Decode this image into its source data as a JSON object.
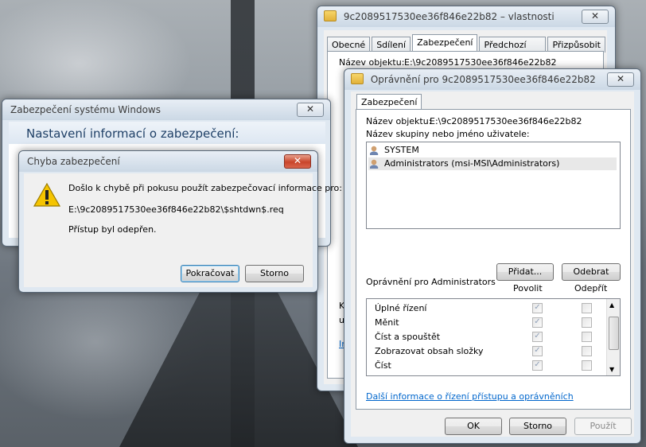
{
  "properties_window": {
    "title": "9c2089517530ee36f846e22b82 – vlastnosti",
    "tabs": [
      "Obecné",
      "Sdílení",
      "Zabezpečení",
      "Předchozí verze",
      "Přizpůsobit"
    ],
    "object_name_label": "Název objektu:",
    "object_name_value": "E:\\9c2089517530ee36f846e22b82",
    "partial_k": "K",
    "partial_u": "u",
    "partial_link": "Ir"
  },
  "permissions_window": {
    "title": "Oprávnění pro 9c2089517530ee36f846e22b82",
    "tab": "Zabezpečení",
    "object_name_label": "Název objektu:",
    "object_name_value": "E:\\9c2089517530ee36f846e22b82",
    "group_label": "Název skupiny nebo jméno uživatele:",
    "users": [
      "SYSTEM",
      "Administrators (msi-MSI\\Administrators)"
    ],
    "add_button": "Přidat...",
    "remove_button": "Odebrat",
    "permissions_for": "Oprávnění pro Administrators",
    "allow_header": "Povolit",
    "deny_header": "Odepřít",
    "permissions": [
      {
        "name": "Úplné řízení",
        "allow": true,
        "deny": false
      },
      {
        "name": "Měnit",
        "allow": true,
        "deny": false
      },
      {
        "name": "Číst a spouštět",
        "allow": true,
        "deny": false
      },
      {
        "name": "Zobrazovat obsah složky",
        "allow": true,
        "deny": false
      },
      {
        "name": "Číst",
        "allow": true,
        "deny": false
      }
    ],
    "info_link": "Další informace o řízení přístupu a oprávněních",
    "ok_button": "OK",
    "cancel_button": "Storno",
    "apply_button": "Použít"
  },
  "windows_security": {
    "title": "Zabezpečení systému Windows",
    "heading": "Nastavení informací o zabezpečení:"
  },
  "error_dialog": {
    "title": "Chyba zabezpečení",
    "message_line1": "Došlo k chybě při pokusu použít zabezpečovací informace pro:",
    "path": "E:\\9c2089517530ee36f846e22b82\\$shtdwn$.req",
    "message_line2": "Přístup byl odepřen.",
    "continue_button": "Pokračovat",
    "cancel_button": "Storno"
  }
}
